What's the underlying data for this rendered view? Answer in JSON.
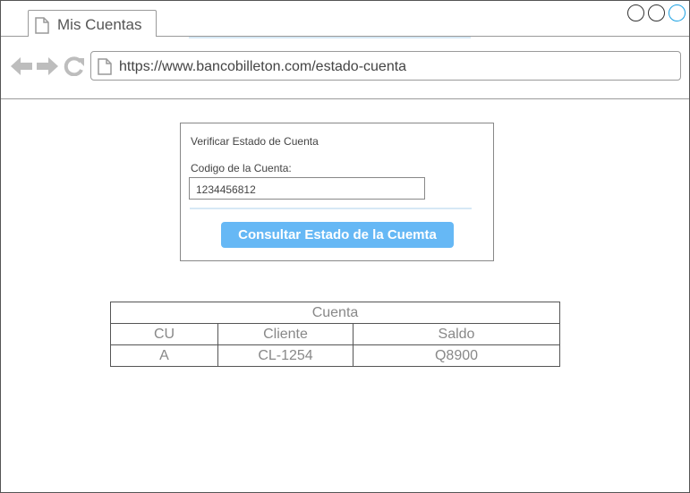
{
  "browser": {
    "tab_title": "Mis Cuentas",
    "url": "https://www.bancobilleton.com/estado-cuenta"
  },
  "form": {
    "title": "Verificar Estado de Cuenta",
    "field_label": "Codigo de la Cuenta:",
    "field_value": "1234456812",
    "submit_label": "Consultar Estado de la Cuemta"
  },
  "table": {
    "caption": "Cuenta",
    "headers": [
      "CU",
      "Cliente",
      "Saldo"
    ],
    "rows": [
      [
        "A",
        "CL-1254",
        "Q8900"
      ]
    ]
  },
  "colors": {
    "accent": "#66b8f5",
    "window_control_active": "#1ba1e2"
  }
}
